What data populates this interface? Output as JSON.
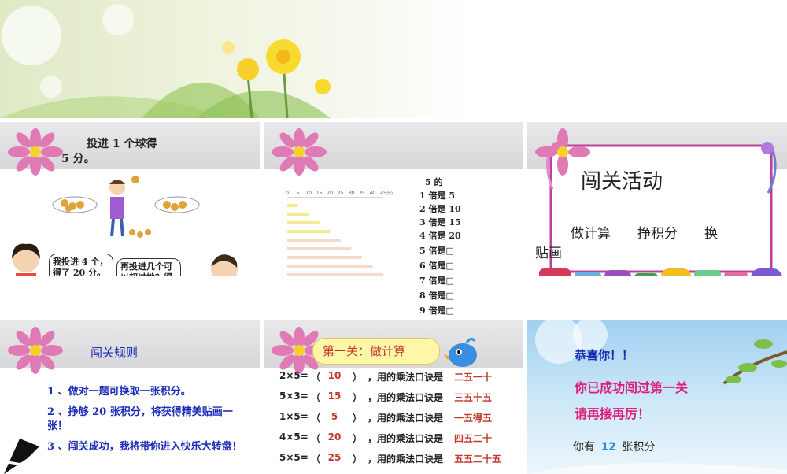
{
  "slide1": {
    "title_line1": "投进 1 个球得",
    "title_line2": "5 分。",
    "girl_bubble": "我投进 4 个，得了 20 分。",
    "boy_bubble": "再投进几个可以超过她？得多少分?"
  },
  "slide2": {
    "header_line1": "5 的",
    "multiples": [
      "1 倍是 5",
      "2 倍是 10",
      "3 倍是 15",
      "4 倍是 20",
      "5 倍是□",
      "6 倍是□",
      "7 倍是□",
      "8 倍是□",
      "9 倍是□"
    ],
    "axis_ticks": [
      "0",
      "5",
      "10",
      "15",
      "20",
      "25",
      "30",
      "35",
      "40",
      "45"
    ],
    "axis_unit": "(分)",
    "chart_data": {
      "type": "bar",
      "categories": [
        "1",
        "2",
        "3",
        "4",
        "5",
        "6",
        "7",
        "8",
        "9"
      ],
      "values": [
        5,
        10,
        15,
        20,
        25,
        30,
        35,
        40,
        45
      ],
      "xlim": [
        0,
        45
      ],
      "colors": [
        "#f3ec8a",
        "#f3ec8a",
        "#f3ec8a",
        "#f3ec8a",
        "#f6d9c8",
        "#f6d9c8",
        "#f6d9c8",
        "#f6d9c8",
        "#f6d9c8"
      ]
    }
  },
  "slide3": {
    "title": "闯关活动",
    "activities": "做计算　　挣积分　　换",
    "activities_tail": "贴画"
  },
  "slide4": {
    "title": "闯关规则",
    "rule1": "1 、做对一题可换取一张积分。",
    "rule2": "2 、挣够 20 张积分，将获得精美贴画一张！",
    "rule3": "3 、闯关成功，我将带你进入快乐大转盘！"
  },
  "slide5": {
    "title": "第一关：做计算",
    "rows": [
      {
        "expr": "2×5=",
        "answer": "10",
        "mid": "，用的乘法口诀是",
        "koujue": "二五一十"
      },
      {
        "expr": "5×3=",
        "answer": "15",
        "mid": "，用的乘法口诀是",
        "koujue": "三五十五"
      },
      {
        "expr": "1×5=",
        "answer": "5",
        "mid": "，用的乘法口诀是",
        "koujue": "一五得五"
      },
      {
        "expr": "4×5=",
        "answer": "20",
        "mid": "，用的乘法口诀是",
        "koujue": "四五二十"
      },
      {
        "expr": "5×5=",
        "answer": "25",
        "mid": "，用的乘法口诀是",
        "koujue": "五五二十五"
      }
    ]
  },
  "slide6": {
    "congrats": "恭喜你！！",
    "passed": "你已成功闯过第一关",
    "next": "请再接再厉！",
    "points_prefix": "你有",
    "points": "12",
    "points_suffix": "张积分"
  },
  "colors": {
    "blue_text": "#1a2bb5",
    "pink_text": "#e0197a",
    "red_answer": "#c0392b"
  }
}
